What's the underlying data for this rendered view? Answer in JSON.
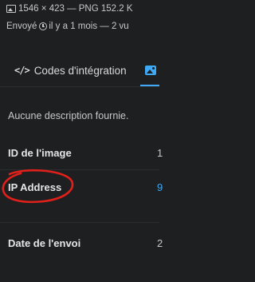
{
  "header": {
    "file_info": "1546 × 423 — PNG 152.2 K",
    "sent_prefix": "Envoyé",
    "sent_relative": "il y a 1 mois — 2 vu"
  },
  "tabs": [
    {
      "label": "Codes d'intégration",
      "icon": "code-icon"
    },
    {
      "label": "",
      "icon": "image-icon",
      "active": true
    }
  ],
  "description": "Aucune description fournie.",
  "details": [
    {
      "label": "ID de l'image",
      "value": "1"
    },
    {
      "label": "IP Address",
      "value": "9"
    },
    {
      "label": "Date de l'envoi",
      "value": "2"
    }
  ],
  "colors": {
    "background": "#1d1f21",
    "accent": "#3fa9f5",
    "annotation": "#e0201a"
  }
}
